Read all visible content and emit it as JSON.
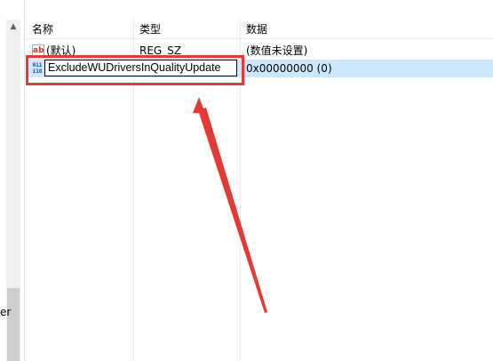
{
  "columns": {
    "name": "名称",
    "type": "类型",
    "data": "数据"
  },
  "rows": [
    {
      "name": "(默认)",
      "type": "REG_SZ",
      "data": "(数值未设置)",
      "icon": "string-value-icon"
    },
    {
      "name": "ExcludeWUDriversInQualityUpdate",
      "type": "",
      "data": "0x00000000 (0)",
      "icon": "dword-value-icon",
      "selected": true,
      "editing": true
    }
  ],
  "left_pane": {
    "partial_text": "er"
  },
  "annotation": {
    "color": "#e53935"
  }
}
